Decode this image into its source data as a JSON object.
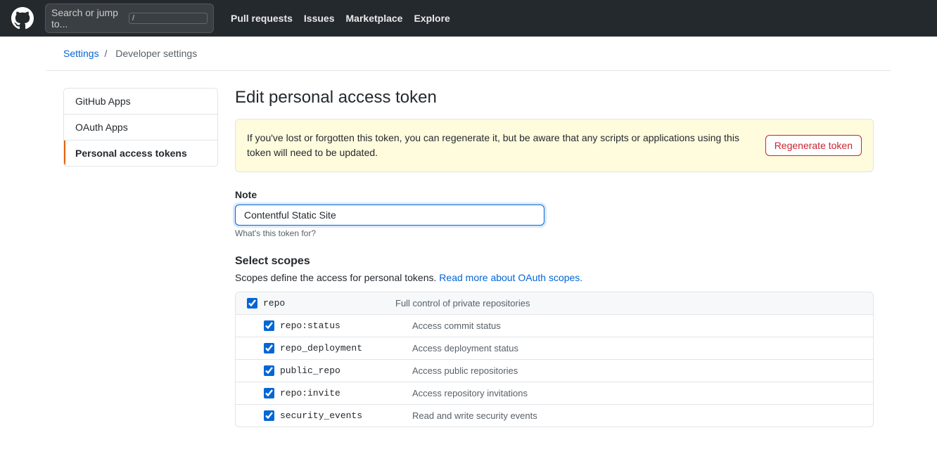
{
  "nav": {
    "search_placeholder": "Search or jump to...",
    "shortcut": "/",
    "links": [
      {
        "label": "Pull requests",
        "id": "pull-requests"
      },
      {
        "label": "Issues",
        "id": "issues"
      },
      {
        "label": "Marketplace",
        "id": "marketplace"
      },
      {
        "label": "Explore",
        "id": "explore"
      }
    ]
  },
  "breadcrumb": {
    "settings_label": "Settings",
    "separator": "/",
    "current": "Developer settings"
  },
  "sidebar": {
    "items": [
      {
        "label": "GitHub Apps",
        "id": "github-apps",
        "active": false
      },
      {
        "label": "OAuth Apps",
        "id": "oauth-apps",
        "active": false
      },
      {
        "label": "Personal access tokens",
        "id": "personal-tokens",
        "active": true
      }
    ]
  },
  "page": {
    "title": "Edit personal access token",
    "warning_text": "If you've lost or forgotten this token, you can regenerate it, but be aware that any scripts or applications using this token will need to be updated.",
    "regenerate_btn": "Regenerate token",
    "note_label": "Note",
    "note_value": "Contentful Static Site",
    "note_hint": "What's this token for?",
    "scopes_title": "Select scopes",
    "scopes_desc": "Scopes define the access for personal tokens.",
    "scopes_link_text": "Read more about OAuth scopes.",
    "scopes_link_href": "#",
    "scopes": [
      {
        "id": "repo",
        "name": "repo",
        "desc": "Full control of private repositories",
        "checked": true,
        "indent": false,
        "children": [
          {
            "id": "repo-status",
            "name": "repo:status",
            "desc": "Access commit status",
            "checked": true
          },
          {
            "id": "repo-deployment",
            "name": "repo_deployment",
            "desc": "Access deployment status",
            "checked": true
          },
          {
            "id": "public-repo",
            "name": "public_repo",
            "desc": "Access public repositories",
            "checked": true
          },
          {
            "id": "repo-invite",
            "name": "repo:invite",
            "desc": "Access repository invitations",
            "checked": true
          },
          {
            "id": "security-events",
            "name": "security_events",
            "desc": "Read and write security events",
            "checked": true
          }
        ]
      }
    ]
  }
}
